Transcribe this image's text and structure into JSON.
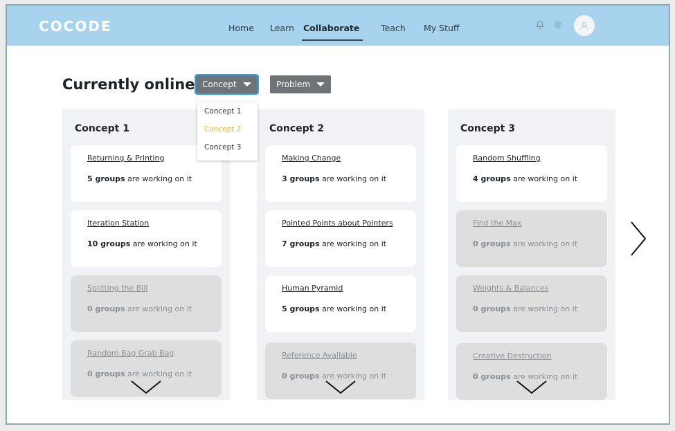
{
  "app": {
    "logo": "COCODE"
  },
  "nav": {
    "items": [
      {
        "label": "Home"
      },
      {
        "label": "Learn"
      },
      {
        "label": "Collaborate"
      },
      {
        "label": "Teach"
      },
      {
        "label": "My Stuff"
      }
    ],
    "active": "Collaborate"
  },
  "page": {
    "title": "Currently online"
  },
  "filters": {
    "concept_label": "Concept",
    "problem_label": "Problem",
    "concept_options": [
      "Concept 1",
      "Concept 2",
      "Concept 3"
    ],
    "highlighted_option": "Concept 2"
  },
  "columns": [
    {
      "title": "Concept 1",
      "cards": [
        {
          "title": "Returning & Printing",
          "count": "5 groups",
          "suffix": " are working on it",
          "active": true
        },
        {
          "title": "Iteration Station",
          "count": "10 groups",
          "suffix": " are working on it",
          "active": true
        },
        {
          "title": "Splitting the Bill",
          "count": "0 groups",
          "suffix": " are working on it",
          "active": false
        },
        {
          "title": "Random Bag Grab Bag",
          "count": "0 groups",
          "suffix": " are working on it",
          "active": false
        }
      ]
    },
    {
      "title": "Concept 2",
      "cards": [
        {
          "title": "Making Change",
          "count": "3 groups",
          "suffix": " are working on it",
          "active": true
        },
        {
          "title": "Pointed Points about Pointers",
          "count": "7 groups",
          "suffix": " are working on it",
          "active": true
        },
        {
          "title": "Human Pyramid",
          "count": "5 groups",
          "suffix": " are working on it",
          "active": true
        },
        {
          "title": "Reference Available",
          "count": "0 groups",
          "suffix": " are working on it",
          "active": false
        }
      ]
    },
    {
      "title": "Concept 3",
      "cards": [
        {
          "title": "Random Shuffling",
          "count": "4 groups",
          "suffix": " are working on it",
          "active": true
        },
        {
          "title": "Find the Max",
          "count": "0 groups",
          "suffix": " are working on it",
          "active": false
        },
        {
          "title": "Weights & Balances",
          "count": "0 groups",
          "suffix": " are working on it",
          "active": false
        },
        {
          "title": "Creative Destruction",
          "count": "0 groups",
          "suffix": " are working on it",
          "active": false
        }
      ]
    }
  ],
  "colors": {
    "topbar": "#a7d3ef",
    "accent_highlight": "#e6b52e",
    "button_bg": "#6e7377",
    "focus_outline": "#3aa0e6"
  },
  "icons": [
    "bell-icon",
    "gear-icon",
    "user-avatar-icon",
    "chevron-down-icon",
    "chevron-right-icon",
    "caret-down-icon"
  ]
}
